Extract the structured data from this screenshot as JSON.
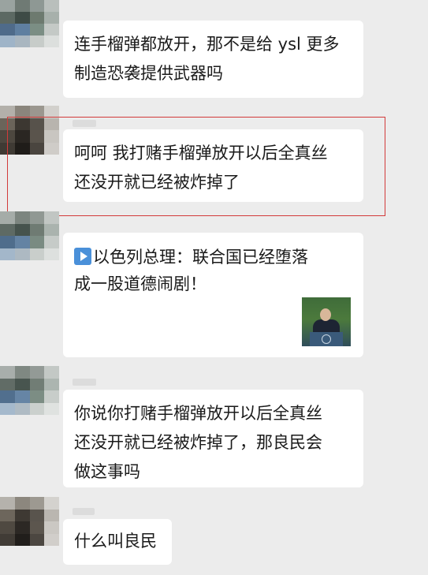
{
  "messages": [
    {
      "lines": [
        "连手榴弹都放开，那不是给 ysl 更多",
        "制造恐袭提供武器吗"
      ]
    },
    {
      "lines": [
        "呵呵 我打赌手榴弹放开以后全真丝",
        "还没开就已经被炸掉了"
      ]
    },
    {
      "link": {
        "title_lines": [
          "以色列总理：联合国已经堕落",
          "成一股道德闹剧！"
        ],
        "icon": "play-icon"
      }
    },
    {
      "lines": [
        "你说你打赌手榴弹放开以后全真丝",
        "还没开就已经被炸掉了，那良民会",
        "做这事吗"
      ]
    },
    {
      "lines": [
        "什么叫良民"
      ]
    }
  ],
  "colors": {
    "background": "#ececec",
    "bubble": "#ffffff",
    "highlight": "#d23a3a",
    "play_icon": "#4a90d9"
  }
}
